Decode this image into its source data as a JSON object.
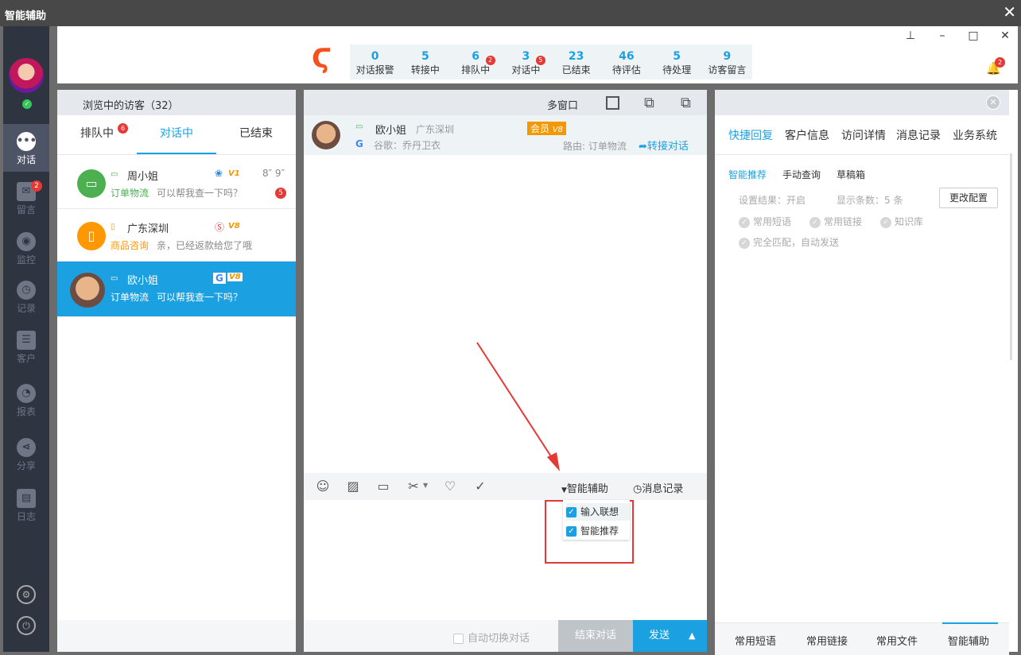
{
  "window": {
    "title": "智能辅助",
    "close": "✕"
  },
  "sidebar": {
    "items": [
      {
        "label": "对话",
        "icon": "chat-icon"
      },
      {
        "label": "留言",
        "icon": "mail-icon",
        "badge": "2"
      },
      {
        "label": "监控",
        "icon": "eye-icon"
      },
      {
        "label": "记录",
        "icon": "clock-icon"
      },
      {
        "label": "客户",
        "icon": "contact-card-icon"
      },
      {
        "label": "报表",
        "icon": "pie-chart-icon"
      },
      {
        "label": "分享",
        "icon": "share-icon"
      },
      {
        "label": "日志",
        "icon": "clipboard-icon"
      }
    ]
  },
  "stats": [
    {
      "num": "0",
      "label": "对话报警"
    },
    {
      "num": "5",
      "label": "转接中"
    },
    {
      "num": "6",
      "label": "排队中",
      "badge": "2"
    },
    {
      "num": "3",
      "label": "对话中",
      "badge": "5"
    },
    {
      "num": "23",
      "label": "已结束"
    },
    {
      "num": "46",
      "label": "待评估"
    },
    {
      "num": "5",
      "label": "待处理"
    },
    {
      "num": "9",
      "label": "访客留言"
    }
  ],
  "bell_badge": "2",
  "left": {
    "header": "浏览中的访客（32）",
    "tabs": [
      "排队中",
      "对话中",
      "已结束"
    ],
    "queue_badge": "6",
    "visitors": [
      {
        "name": "周小姐",
        "tag": "订单物流",
        "msg": "可以帮我查一下吗？",
        "time": "8″ 9″",
        "badge": "5",
        "vip": "V1"
      },
      {
        "name": "广东深圳",
        "tag": "商品咨询",
        "msg": "亲，已经返款给您了哦",
        "vip": "V8"
      },
      {
        "name": "欧小姐",
        "tag": "订单物流",
        "msg": "可以帮我查一下吗？",
        "vip": "V8"
      }
    ]
  },
  "chat": {
    "multi_window": "多窗口",
    "name": "欧小姐",
    "location": "广东深圳",
    "member": "会员",
    "vip": "V8",
    "source": "谷歌：乔丹卫衣",
    "route": "路由: 订单物流",
    "transfer": "转接对话",
    "assist": "智能辅助",
    "history": "消息记录",
    "menu": [
      "输入联想",
      "智能推荐"
    ],
    "auto_switch": "自动切换对话",
    "end": "结束对话",
    "send": "发送"
  },
  "right": {
    "tabs": [
      "快捷回复",
      "客户信息",
      "访问详情",
      "消息记录",
      "业务系统"
    ],
    "subtabs": [
      "智能推荐",
      "手动查询",
      "草稿箱"
    ],
    "setting_result": "设置结果：开启",
    "display_count": "显示条数：5 条",
    "change_config": "更改配置",
    "options": [
      "常用短语",
      "常用链接",
      "知识库",
      "完全匹配，自动发送"
    ],
    "bottom_tabs": [
      "常用短语",
      "常用链接",
      "常用文件",
      "智能辅助"
    ]
  }
}
